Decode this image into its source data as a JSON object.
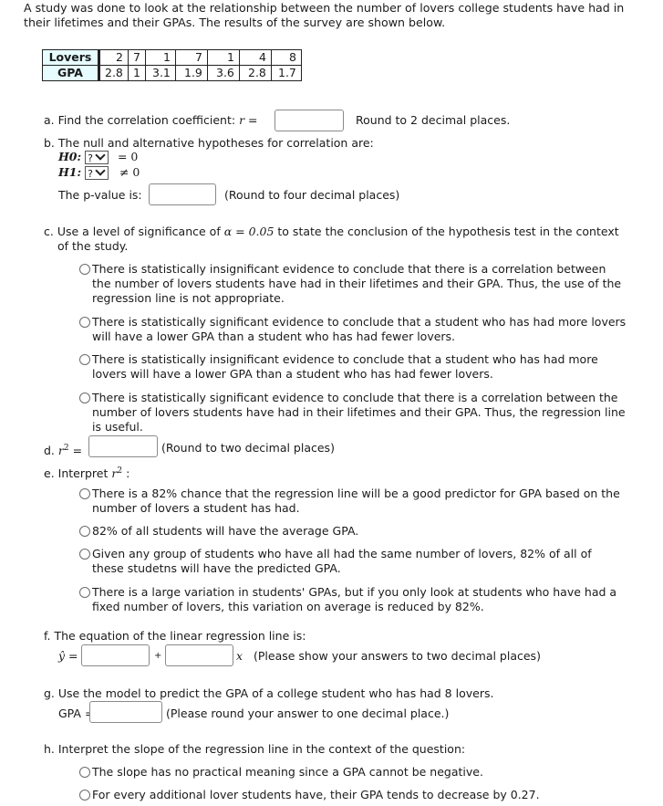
{
  "intro": "A study was done to look at the relationship between the number of lovers college students have had in their lifetimes and their GPAs. The results of the survey are shown below.",
  "table": {
    "rows": [
      {
        "header": "Lovers",
        "values": [
          "2",
          "7",
          "1",
          "7",
          "1",
          "4",
          "8"
        ]
      },
      {
        "header": "GPA",
        "values": [
          "2.8",
          "1",
          "3.1",
          "1.9",
          "3.6",
          "2.8",
          "1.7"
        ]
      }
    ]
  },
  "chart_data": {
    "type": "table",
    "title": "",
    "columns": [
      "Lovers",
      "GPA"
    ],
    "x": [
      2,
      7,
      1,
      7,
      1,
      4,
      8
    ],
    "y": [
      2.8,
      1,
      3.1,
      1.9,
      3.6,
      2.8,
      1.7
    ]
  },
  "part_a": {
    "label": "a. Find the correlation coefficient:",
    "symbol": "r =",
    "value": "",
    "hint": "Round to 2 decimal places."
  },
  "part_b": {
    "label": "b. The null and alternative hypotheses for correlation are:",
    "h0_label": "H0:",
    "h0_select": "?",
    "h0_rel": "= 0",
    "h1_label": "H1:",
    "h1_select": "?",
    "h1_rel": "≠ 0",
    "pvalue_label": "The p-value is:",
    "pvalue_value": "",
    "pvalue_hint": "(Round to four decimal places)"
  },
  "part_c": {
    "label_pre": "c. Use a level of significance of",
    "alpha": "α = 0.05",
    "label_post": "to state the conclusion of the hypothesis test in the context",
    "label_line2": "of the study.",
    "options": [
      "There is statistically insignificant evidence to conclude that there is a correlation between the number of lovers students have had in their lifetimes and their GPA. Thus, the use of the regression line is not appropriate.",
      "There is statistically significant evidence to conclude that a student who has had more lovers will have a lower GPA than a student who has had fewer lovers.",
      "There is statistically insignificant evidence to conclude that a student who has had more lovers will have a lower GPA than a student who has had fewer lovers.",
      "There is statistically significant evidence to conclude that there is a correlation between the number of lovers students have had in their lifetimes and their GPA. Thus, the regression line is useful."
    ]
  },
  "part_d": {
    "label": "d.",
    "symbol": "r",
    "eq": "=",
    "value": "",
    "hint": "(Round to two decimal places)"
  },
  "part_e": {
    "label": "e. Interpret",
    "symbol": "r",
    "colon": ":",
    "options": [
      "There is a 82% chance that the regression line will be a good predictor for GPA based on the number of lovers a student has had.",
      "82% of all students will have the average GPA.",
      "Given any group of students who have all had the same number of lovers, 82% of all of these studetns will have the predicted GPA.",
      "There is a large variation in students' GPAs, but if you only look at students who have had a fixed number of lovers, this variation on average is reduced by 82%."
    ]
  },
  "part_f": {
    "label": "f. The equation of the linear regression line is:",
    "yhat": "ŷ",
    "eq": "=",
    "intercept_value": "",
    "plus": "+",
    "slope_value": "",
    "x": "x",
    "hint": "(Please show your answers to two decimal places)"
  },
  "part_g": {
    "label": "g. Use the model to predict the GPA of a college student who has had 8 lovers.",
    "gpa_label": "GPA =",
    "value": "",
    "hint": "(Please round your answer to one decimal place.)"
  },
  "part_h": {
    "label": "h. Interpret the slope of the regression line in the context of the question:",
    "options": [
      "The slope has no practical meaning since a GPA cannot be negative.",
      "For every additional lover students have, their GPA tends to decrease by 0.27."
    ]
  }
}
